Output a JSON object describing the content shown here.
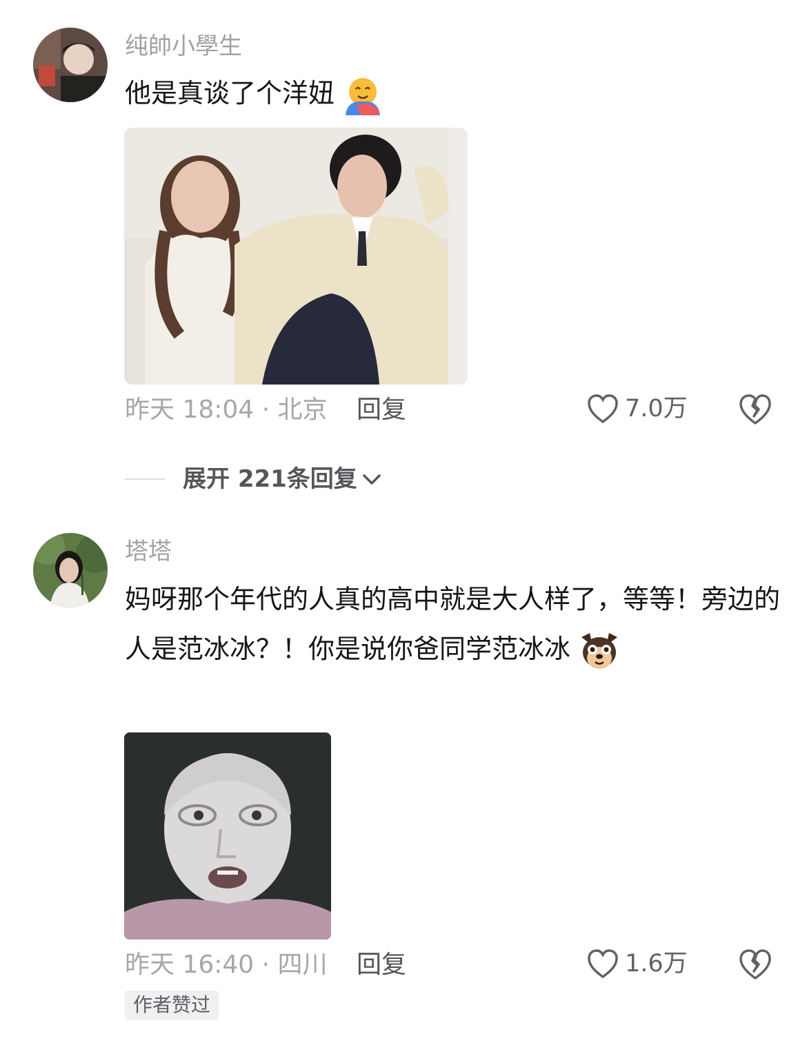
{
  "comments": [
    {
      "username": "纯帥小學生",
      "text": "他是真谈了个洋妞",
      "time_location": "昨天 18:04 · 北京",
      "reply_label": "回复",
      "likes": "7.0万"
    },
    {
      "username": "塔塔",
      "text": "妈呀那个年代的人真的高中就是大人样了，等等！旁边的人是范冰冰？！你是说你爸同学范冰冰",
      "time_location": "昨天 16:40 · 四川",
      "reply_label": "回复",
      "likes": "1.6万",
      "badge": "作者赞过"
    }
  ],
  "expand_replies": "展开 221条回复",
  "icons": [
    "heart-outline-icon",
    "broken-heart-icon",
    "chevron-down-icon",
    "hug-emoji-icon",
    "dog-emoji-icon"
  ],
  "colors": {
    "username": "#a1a1a6",
    "text": "#16161a",
    "meta": "#a6a6ab",
    "badge_bg": "#f0f0f2"
  }
}
